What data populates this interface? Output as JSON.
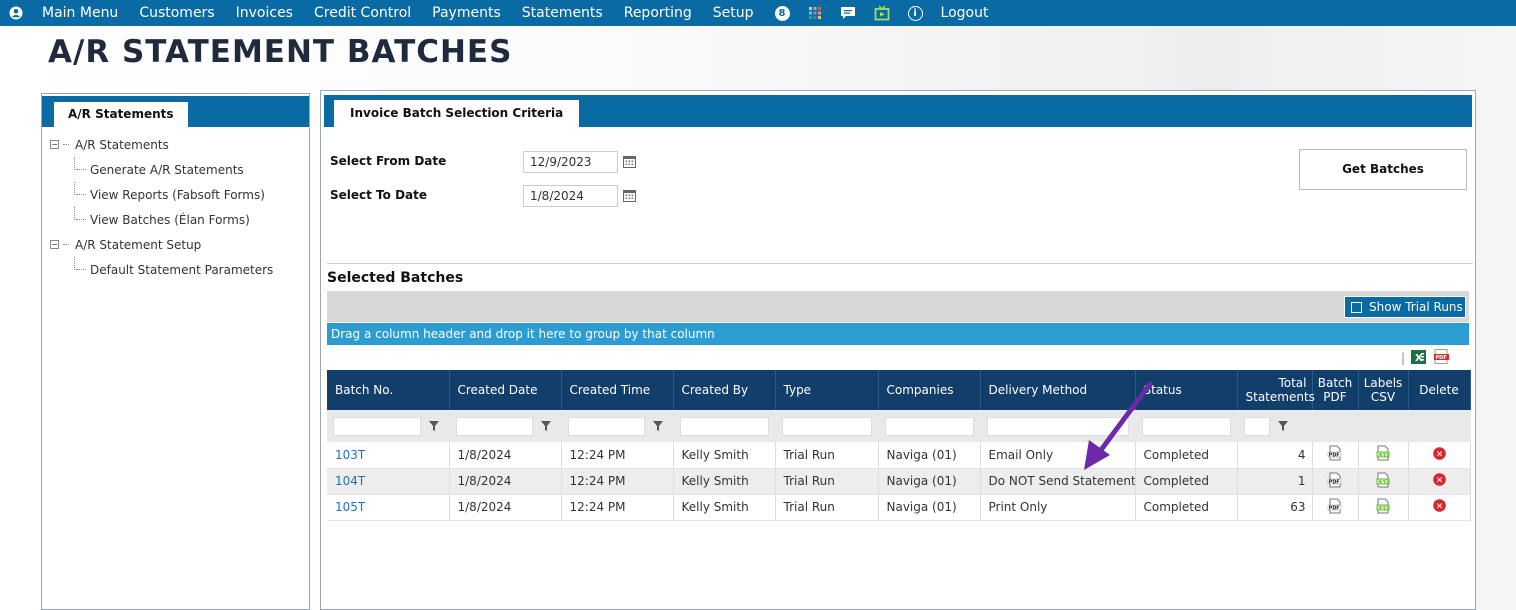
{
  "nav": {
    "items": [
      "Main Menu",
      "Customers",
      "Invoices",
      "Credit Control",
      "Payments",
      "Statements",
      "Reporting",
      "Setup"
    ],
    "badge": "8",
    "logout": "Logout",
    "info_glyph": "i"
  },
  "page_title": "A/R STATEMENT BATCHES",
  "sidebar": {
    "tab": "A/R Statements",
    "tree": [
      {
        "label": "A/R Statements",
        "expander": "−",
        "children": [
          "Generate A/R Statements",
          "View Reports (Fabsoft Forms)",
          "View Batches (Élan Forms)"
        ]
      },
      {
        "label": "A/R Statement Setup",
        "expander": "−",
        "children": [
          "Default Statement Parameters"
        ]
      }
    ]
  },
  "criteria": {
    "tab": "Invoice Batch Selection Criteria",
    "from_label": "Select From Date",
    "from_value": "12/9/2023",
    "to_label": "Select To Date",
    "to_value": "1/8/2024",
    "get_batches": "Get Batches"
  },
  "batches": {
    "title": "Selected Batches",
    "show_trial_runs": "Show Trial Runs",
    "group_hint": "Drag a column header and drop it here to group by that column",
    "export_separator": "|",
    "columns": {
      "batch_no": "Batch No.",
      "created_date": "Created Date",
      "created_time": "Created Time",
      "created_by": "Created By",
      "type": "Type",
      "companies": "Companies",
      "delivery_method": "Delivery Method",
      "status": "Status",
      "total_l1": "Total",
      "total_l2": "Statements",
      "pdf_l1": "Batch",
      "pdf_l2": "PDF",
      "csv_l1": "Labels",
      "csv_l2": "CSV",
      "delete": "Delete"
    },
    "rows": [
      {
        "batch_no": "103T",
        "created_date": "1/8/2024",
        "created_time": "12:24 PM",
        "created_by": "Kelly Smith",
        "type": "Trial Run",
        "companies": "Naviga (01)",
        "delivery_method": "Email Only",
        "status": "Completed",
        "total": "4"
      },
      {
        "batch_no": "104T",
        "created_date": "1/8/2024",
        "created_time": "12:24 PM",
        "created_by": "Kelly Smith",
        "type": "Trial Run",
        "companies": "Naviga (01)",
        "delivery_method": "Do NOT Send Statement",
        "status": "Completed",
        "total": "1"
      },
      {
        "batch_no": "105T",
        "created_date": "1/8/2024",
        "created_time": "12:24 PM",
        "created_by": "Kelly Smith",
        "type": "Trial Run",
        "companies": "Naviga (01)",
        "delivery_method": "Print Only",
        "status": "Completed",
        "total": "63"
      }
    ]
  },
  "icons": {
    "user": "user-circle-icon",
    "grid": "grid-icon",
    "chat": "chat-icon",
    "tv": "tv-icon",
    "info": "info-icon",
    "calendar": "calendar-icon",
    "filter": "filter-icon",
    "excel": "excel-export-icon",
    "pdf": "pdf-export-icon",
    "batch_pdf": "pdf-file-icon",
    "labels_csv": "csv-file-icon",
    "delete": "delete-icon",
    "excel_glyph": "X",
    "pdf_glyph": "PDF",
    "csv_glyph": "CSV",
    "delete_glyph": "✕"
  },
  "colors": {
    "nav_bg": "#0a6aa4",
    "grid_header": "#123e6c",
    "group_bar": "#2b9dd3",
    "link": "#1e73b8",
    "delete": "#d9262b",
    "arrow": "#6b2aa8"
  }
}
